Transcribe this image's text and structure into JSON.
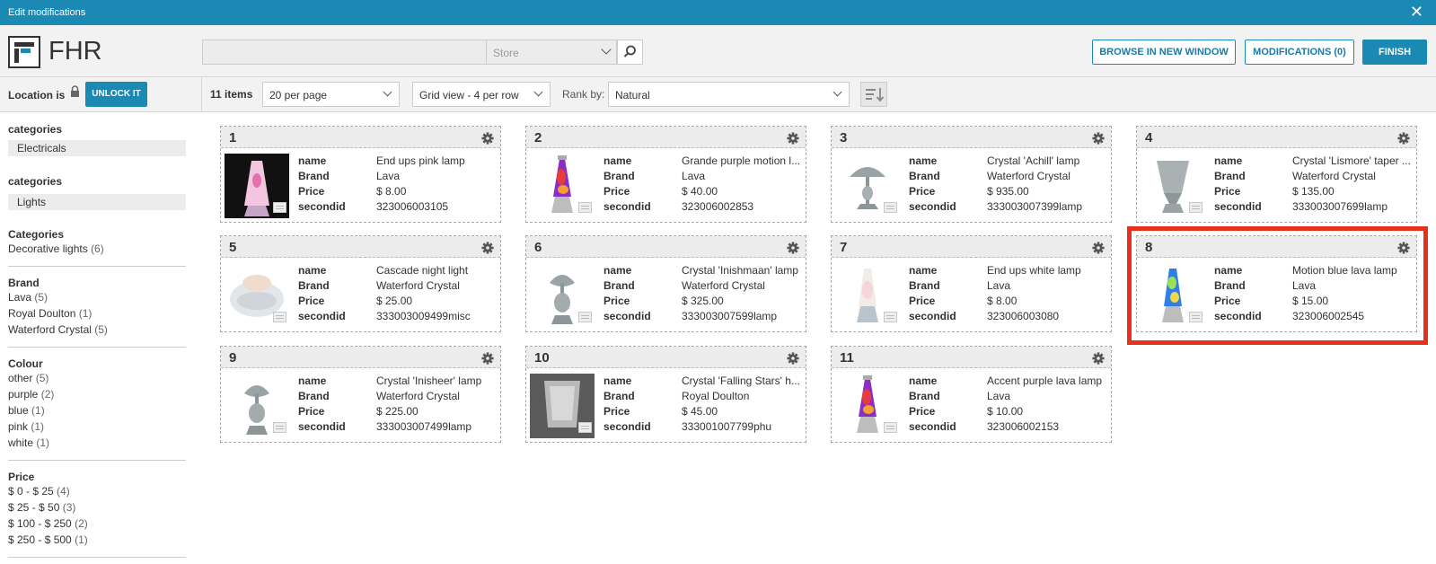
{
  "window": {
    "title": "Edit modifications"
  },
  "header": {
    "logo_text": "FHR",
    "search_value": "",
    "store_placeholder": "Store",
    "browse_button": "BROWSE IN NEW WINDOW",
    "modifications_button": "MODIFICATIONS (0)",
    "finish_button": "FINISH"
  },
  "location": {
    "label": "Location is",
    "unlock_button": "UNLOCK IT"
  },
  "results": {
    "count": "11 items",
    "per_page": "20 per page",
    "view": "Grid view - 4 per row",
    "rank_label": "Rank by:",
    "rank_value": "Natural"
  },
  "sidebar": {
    "selected_1": {
      "title": "categories",
      "value": "Electricals"
    },
    "selected_2": {
      "title": "categories",
      "value": "Lights"
    },
    "categories": {
      "title": "Categories",
      "items": [
        {
          "label": "Decorative lights",
          "count": "(6)"
        }
      ]
    },
    "brand": {
      "title": "Brand",
      "items": [
        {
          "label": "Lava",
          "count": "(5)"
        },
        {
          "label": "Royal Doulton",
          "count": "(1)"
        },
        {
          "label": "Waterford Crystal",
          "count": "(5)"
        }
      ]
    },
    "colour": {
      "title": "Colour",
      "items": [
        {
          "label": "other",
          "count": "(5)"
        },
        {
          "label": "purple",
          "count": "(2)"
        },
        {
          "label": "blue",
          "count": "(1)"
        },
        {
          "label": "pink",
          "count": "(1)"
        },
        {
          "label": "white",
          "count": "(1)"
        }
      ]
    },
    "price": {
      "title": "Price",
      "items": [
        {
          "label": "$ 0 - $ 25",
          "count": "(4)"
        },
        {
          "label": "$ 25 - $ 50",
          "count": "(3)"
        },
        {
          "label": "$ 100 - $ 250",
          "count": "(2)"
        },
        {
          "label": "$ 250 - $ 500",
          "count": "(1)"
        }
      ]
    }
  },
  "field_labels": {
    "name": "name",
    "brand": "Brand",
    "price": "Price",
    "secondid": "secondid"
  },
  "products": [
    {
      "num": "1",
      "name": "End ups pink lamp",
      "brand": "Lava",
      "price": "$ 8.00",
      "secondid": "323006003105",
      "thumb": "pink-lava-lamp"
    },
    {
      "num": "2",
      "name": "Grande purple motion l...",
      "brand": "Lava",
      "price": "$ 40.00",
      "secondid": "323006002853",
      "thumb": "purple-lava-lamp"
    },
    {
      "num": "3",
      "name": "Crystal 'Achill' lamp",
      "brand": "Waterford Crystal",
      "price": "$ 935.00",
      "secondid": "333003007399lamp",
      "thumb": "crystal-table-lamp"
    },
    {
      "num": "4",
      "name": "Crystal 'Lismore' taper ...",
      "brand": "Waterford Crystal",
      "price": "$ 135.00",
      "secondid": "333003007699lamp",
      "thumb": "crystal-taper-lamp"
    },
    {
      "num": "5",
      "name": "Cascade night light",
      "brand": "Waterford Crystal",
      "price": "$ 25.00",
      "secondid": "333003009499misc",
      "thumb": "crystal-night-light"
    },
    {
      "num": "6",
      "name": "Crystal 'Inishmaan' lamp",
      "brand": "Waterford Crystal",
      "price": "$ 325.00",
      "secondid": "333003007599lamp",
      "thumb": "crystal-lamp"
    },
    {
      "num": "7",
      "name": "End ups white lamp",
      "brand": "Lava",
      "price": "$ 8.00",
      "secondid": "323006003080",
      "thumb": "white-lava-lamp"
    },
    {
      "num": "8",
      "name": "Motion blue lava lamp",
      "brand": "Lava",
      "price": "$ 15.00",
      "secondid": "323006002545",
      "thumb": "blue-lava-lamp"
    },
    {
      "num": "9",
      "name": "Crystal 'Inisheer' lamp",
      "brand": "Waterford Crystal",
      "price": "$ 225.00",
      "secondid": "333003007499lamp",
      "thumb": "crystal-lamp"
    },
    {
      "num": "10",
      "name": "Crystal 'Falling Stars' h...",
      "brand": "Royal Doulton",
      "price": "$ 45.00",
      "secondid": "333001007799phu",
      "thumb": "crystal-hurricane"
    },
    {
      "num": "11",
      "name": "Accent purple lava lamp",
      "brand": "Lava",
      "price": "$ 10.00",
      "secondid": "323006002153",
      "thumb": "purple-lava-lamp"
    }
  ],
  "colors": {
    "accent": "#1a8ab5",
    "highlight": "#e8301c",
    "panel": "#f2f2f2"
  }
}
